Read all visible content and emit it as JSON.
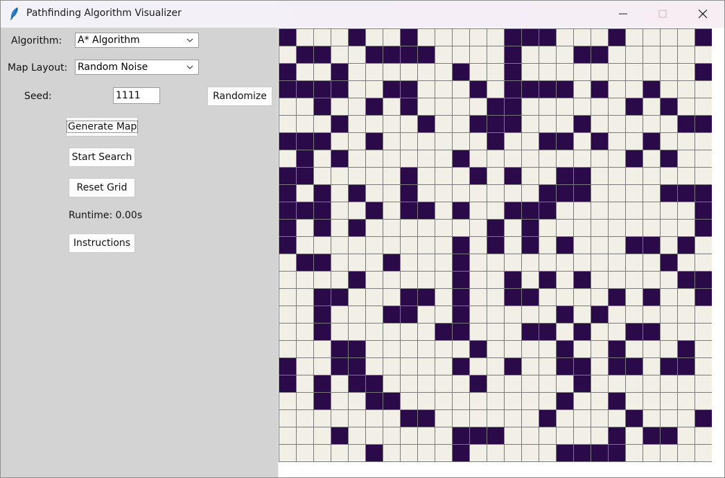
{
  "window": {
    "title": "Pathfinding Algorithm Visualizer"
  },
  "controls": {
    "algorithm_label": "Algorithm:",
    "algorithm_value": "A* Algorithm",
    "map_layout_label": "Map Layout:",
    "map_layout_value": "Random Noise",
    "seed_label": "Seed:",
    "seed_value": "1111",
    "randomize_label": "Randomize",
    "generate_label": "Generate Map",
    "start_label": "Start Search",
    "reset_label": "Reset Grid",
    "runtime_text": "Runtime: 0.00s",
    "instructions_label": "Instructions"
  },
  "grid": {
    "rows": 25,
    "cols": 25,
    "wall_color": "#2b0a4a",
    "empty_color": "#f2efe6",
    "line_color": "#7a7a7a",
    "cells": [
      "1000100100000111000100001",
      "0110011110000100011000000",
      "1001000000100100000000001",
      "1111001100010111101001000",
      "0010010100001100000010100",
      "0001000010011100010000011",
      "1110010000001001101001000",
      "0101000000100000000010100",
      "1100000100010100110000000",
      "1010100100000001110000111",
      "1110010110100111000000001",
      "1010100000001010000000001",
      "1000000000101010100011010",
      "0110001000100000000000100",
      "0000100000100101010000011",
      "0011000110100110000101001",
      "0010001100100000101000000",
      "0010000001100011010011000",
      "0001100000010000100100010",
      "1001100000100100110110110",
      "1010110000010000010000000",
      "0010011000000000100100000",
      "0000000110000001000010001",
      "0001000000111000000101100",
      "0000010000100000111100000"
    ]
  }
}
